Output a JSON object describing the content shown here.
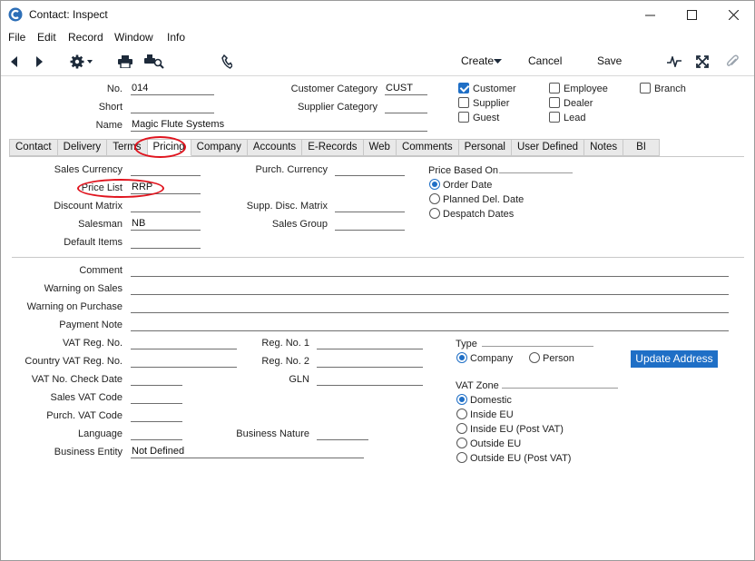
{
  "window": {
    "title": "Contact: Inspect"
  },
  "menu": [
    "File",
    "Edit",
    "Record",
    "Window",
    "Info"
  ],
  "toolbar": {
    "create_label": "Create",
    "cancel_label": "Cancel",
    "save_label": "Save"
  },
  "header": {
    "no_label": "No.",
    "no_value": "014",
    "short_label": "Short",
    "short_value": "",
    "name_label": "Name",
    "name_value": "Magic Flute Systems",
    "cust_cat_label": "Customer Category",
    "cust_cat_value": "CUST",
    "supp_cat_label": "Supplier Category",
    "supp_cat_value": ""
  },
  "checkboxes": {
    "customer": {
      "label": "Customer",
      "checked": true
    },
    "supplier": {
      "label": "Supplier",
      "checked": false
    },
    "guest": {
      "label": "Guest",
      "checked": false
    },
    "employee": {
      "label": "Employee",
      "checked": false
    },
    "dealer": {
      "label": "Dealer",
      "checked": false
    },
    "lead": {
      "label": "Lead",
      "checked": false
    },
    "branch": {
      "label": "Branch",
      "checked": false
    }
  },
  "tabs": [
    "Contact",
    "Delivery",
    "Terms",
    "Pricing",
    "Company",
    "Accounts",
    "E-Records",
    "Web",
    "Comments",
    "Personal",
    "User Defined",
    "Notes",
    "BI"
  ],
  "active_tab": "Pricing",
  "pricing": {
    "sales_currency_label": "Sales Currency",
    "sales_currency_value": "",
    "price_list_label": "Price List",
    "price_list_value": "RRP",
    "discount_matrix_label": "Discount Matrix",
    "discount_matrix_value": "",
    "salesman_label": "Salesman",
    "salesman_value": "NB",
    "default_items_label": "Default Items",
    "default_items_value": "",
    "purch_currency_label": "Purch. Currency",
    "purch_currency_value": "",
    "supp_disc_matrix_label": "Supp. Disc. Matrix",
    "supp_disc_matrix_value": "",
    "sales_group_label": "Sales Group",
    "sales_group_value": "",
    "price_based_on_label": "Price Based On",
    "price_based_on_options": [
      "Order Date",
      "Planned Del. Date",
      "Despatch Dates"
    ],
    "price_based_on_selected": 0
  },
  "lower": {
    "comment_label": "Comment",
    "warning_sales_label": "Warning on Sales",
    "warning_purchase_label": "Warning on Purchase",
    "payment_note_label": "Payment Note",
    "vat_reg_label": "VAT Reg. No.",
    "country_vat_label": "Country VAT Reg. No.",
    "vat_check_date_label": "VAT No. Check Date",
    "sales_vat_code_label": "Sales VAT Code",
    "purch_vat_code_label": "Purch. VAT Code",
    "language_label": "Language",
    "business_entity_label": "Business Entity",
    "business_entity_value": "Not Defined",
    "reg1_label": "Reg. No. 1",
    "reg2_label": "Reg. No. 2",
    "gln_label": "GLN",
    "business_nature_label": "Business Nature",
    "type_label": "Type",
    "type_options": [
      "Company",
      "Person"
    ],
    "type_selected": 0,
    "update_address_label": "Update Address",
    "vat_zone_label": "VAT Zone",
    "vat_zone_options": [
      "Domestic",
      "Inside EU",
      "Inside EU (Post VAT)",
      "Outside EU",
      "Outside EU (Post VAT)"
    ],
    "vat_zone_selected": 0
  },
  "colors": {
    "accent": "#1f6fc6",
    "highlight_oval": "#e0141e"
  }
}
